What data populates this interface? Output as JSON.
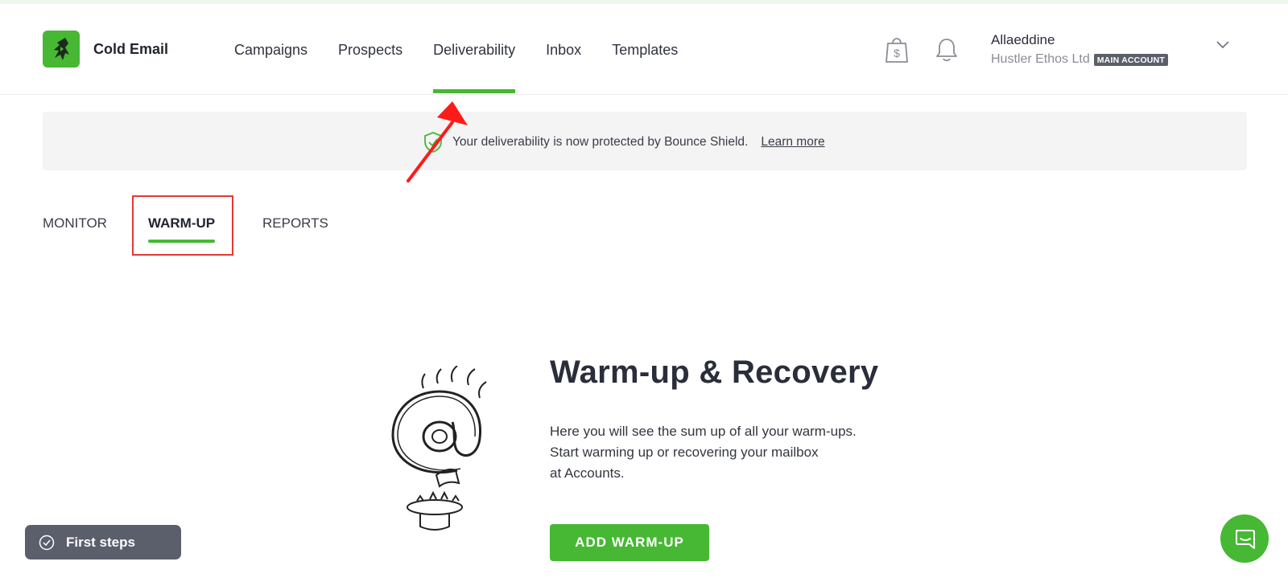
{
  "app": {
    "brand": "Cold Email",
    "accent_color": "#46b833"
  },
  "nav": {
    "items": [
      {
        "label": "Campaigns"
      },
      {
        "label": "Prospects"
      },
      {
        "label": "Deliverability",
        "active": true
      },
      {
        "label": "Inbox"
      },
      {
        "label": "Templates"
      }
    ]
  },
  "header_icons": {
    "billing": "shopping-bag-dollar-icon",
    "notifications": "bell-icon"
  },
  "user": {
    "name": "Allaeddine",
    "company": "Hustler Ethos Ltd",
    "badge": "MAIN ACCOUNT"
  },
  "banner": {
    "text": "Your deliverability is now protected by Bounce Shield.",
    "link": "Learn more",
    "icon": "shield-check-icon"
  },
  "tabs": [
    {
      "label": "MONITOR"
    },
    {
      "label": "WARM-UP",
      "active": true
    },
    {
      "label": "REPORTS"
    }
  ],
  "hero": {
    "title": "Warm-up & Recovery",
    "description": [
      "Here you will see the sum up of all your warm-ups.",
      "Start warming up or recovering your mailbox",
      "at Accounts."
    ],
    "button": "ADD WARM-UP",
    "illustration": "at-sign-on-burner-illustration"
  },
  "first_steps": {
    "label": "First steps",
    "icon": "check-circle-icon"
  },
  "chat": {
    "icon": "chat-icon"
  },
  "annotations": {
    "arrow_color": "#ff1a1a",
    "highlight_color": "#e53935"
  }
}
